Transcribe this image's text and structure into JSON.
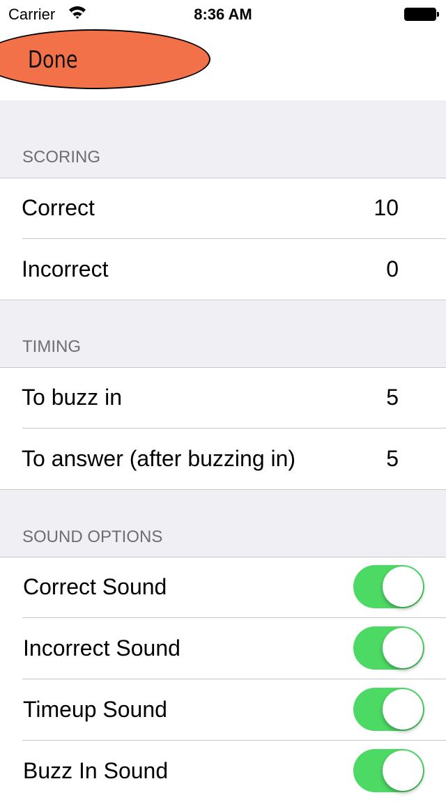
{
  "status_bar": {
    "carrier": "Carrier",
    "time": "8:36 AM"
  },
  "nav": {
    "done_label": "Done"
  },
  "sections": [
    {
      "header": "SCORING",
      "rows": [
        {
          "label": "Correct",
          "value": "10"
        },
        {
          "label": "Incorrect",
          "value": "0"
        }
      ]
    },
    {
      "header": "TIMING",
      "rows": [
        {
          "label": "To buzz in",
          "value": "5"
        },
        {
          "label": "To answer (after buzzing in)",
          "value": "5"
        }
      ]
    },
    {
      "header": "SOUND OPTIONS",
      "rows": [
        {
          "label": "Correct Sound",
          "on": true
        },
        {
          "label": "Incorrect Sound",
          "on": true
        },
        {
          "label": "Timeup Sound",
          "on": true
        },
        {
          "label": "Buzz In Sound",
          "on": true
        }
      ]
    }
  ],
  "colors": {
    "accent": "#4cd964",
    "done": "#f27148"
  }
}
